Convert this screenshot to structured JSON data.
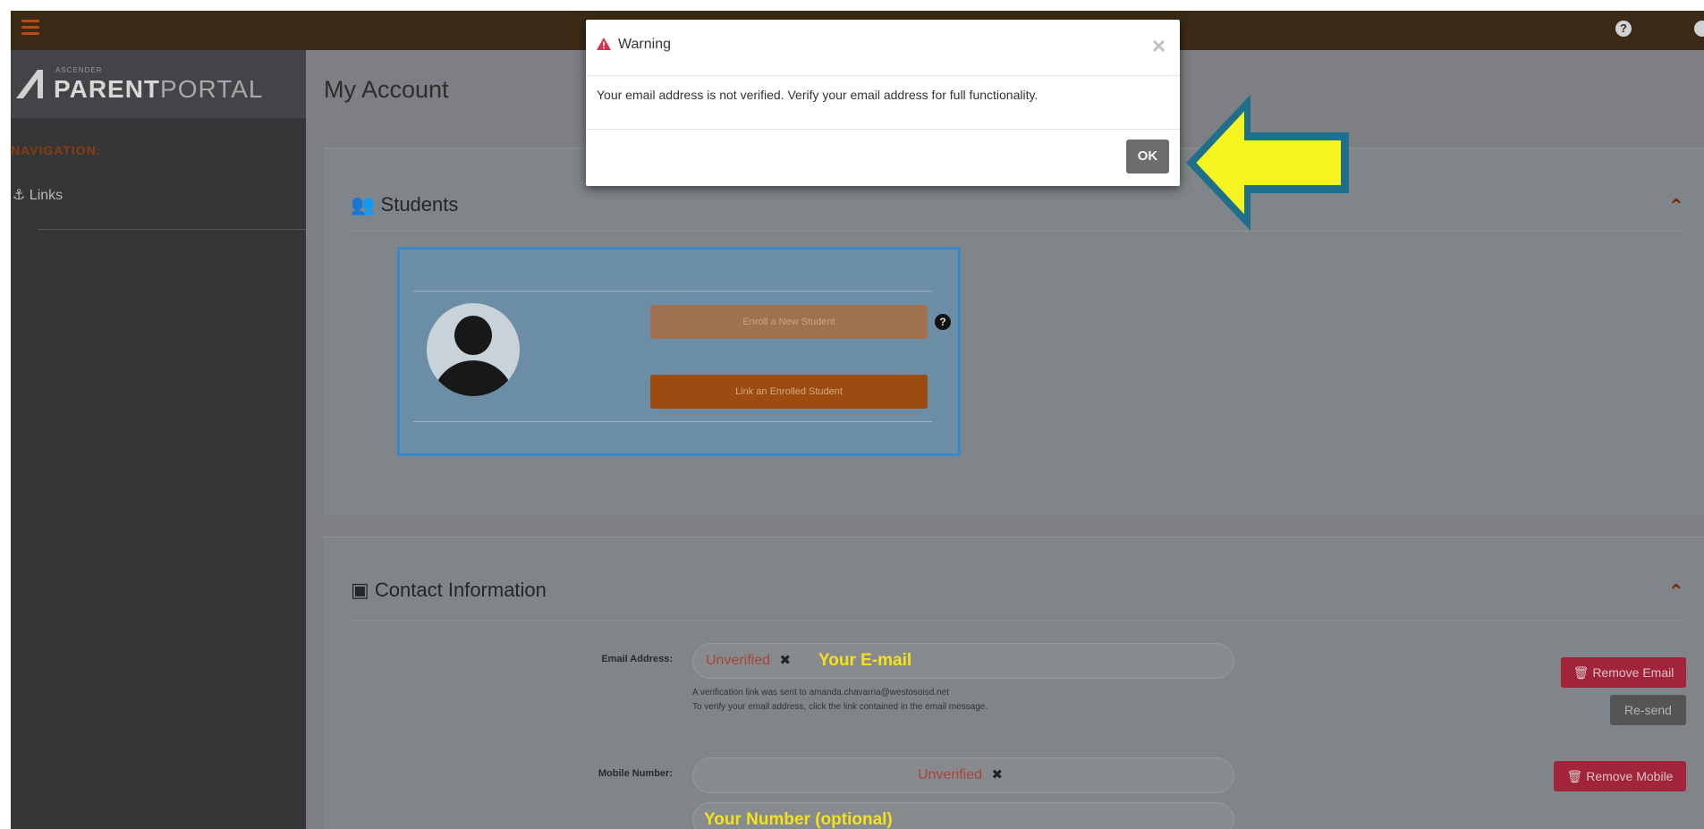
{
  "topbar": {
    "help_icon": "question-circle-icon",
    "user_icon": "user-circle-icon"
  },
  "sidebar": {
    "logo_small": "ASCENDER",
    "logo_bold": "PARENT",
    "logo_light": "PORTAL",
    "nav_heading": "NAVIGATION:",
    "links_label": "Links",
    "links_icon": "anchor-icon"
  },
  "main": {
    "title": "My Account",
    "students": {
      "title": "Students",
      "icon": "users-icon",
      "enroll_label": "Enroll a New Student",
      "link_label": "Link an Enrolled Student",
      "help": "?"
    },
    "contact": {
      "title": "Contact Information",
      "icon": "address-book-icon",
      "email_label": "Email Address:",
      "email_status": "Unverified",
      "email_x": "✖",
      "email_placeholder": "Your E-mail",
      "note_line1": "A verification link was sent to amanda.chavarria@westosoisd.net",
      "note_line2": "To verify your email address, click the link contained in the email message.",
      "remove_email": "Remove Email",
      "resend": "Re-send",
      "mobile_label": "Mobile Number:",
      "mobile_status": "Unverified",
      "mobile_x": "✖",
      "remove_mobile": "Remove Mobile",
      "mobile_placeholder": "Your Number (optional)"
    }
  },
  "modal": {
    "title": "Warning",
    "message": "Your email address is not verified. Verify your email address for full functionality.",
    "close": "×",
    "ok": "OK"
  },
  "colors": {
    "arrow_fill": "#f7f520",
    "arrow_border": "#1f6f8b",
    "accent_orange": "#9c4c10",
    "danger": "#a1243b"
  }
}
